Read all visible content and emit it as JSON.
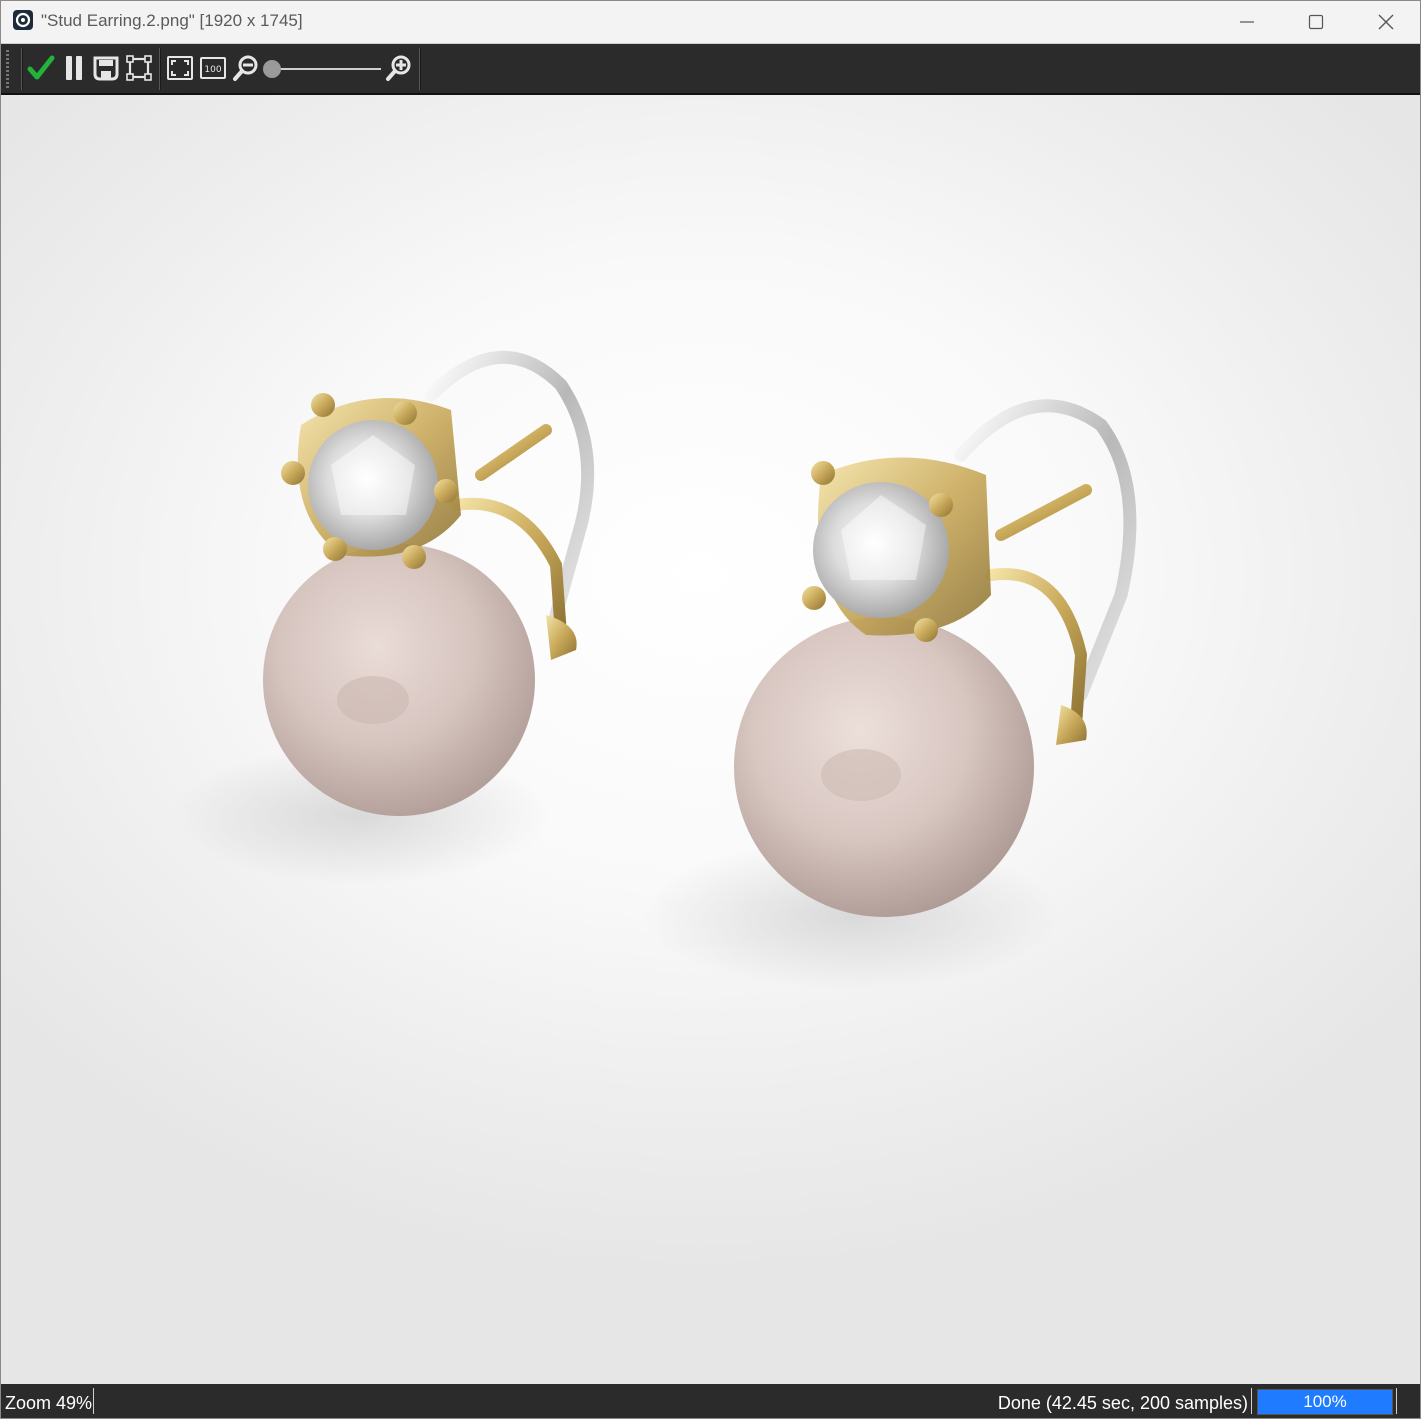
{
  "window": {
    "title": "\"Stud Earring.2.png\" [1920 x 1745]"
  },
  "toolbar": {
    "icons": [
      "check-icon",
      "pause-icon",
      "save-icon",
      "crop-icon",
      "fit-icon",
      "zoom-100-icon",
      "zoom-out-icon",
      "zoom-in-icon"
    ],
    "zoom_100_label": "100",
    "zoom_slider_level": 0
  },
  "status": {
    "zoom": "Zoom 49%",
    "render": "Done (42.45 sec, 200 samples)",
    "progress_label": "100%",
    "progress_value": 100
  },
  "colors": {
    "accent": "#1f7bff",
    "check": "#22b33a",
    "toolbar_bg": "#2b2b2b",
    "gold": "#d9c27a",
    "pearl": "#d8c7c2"
  }
}
